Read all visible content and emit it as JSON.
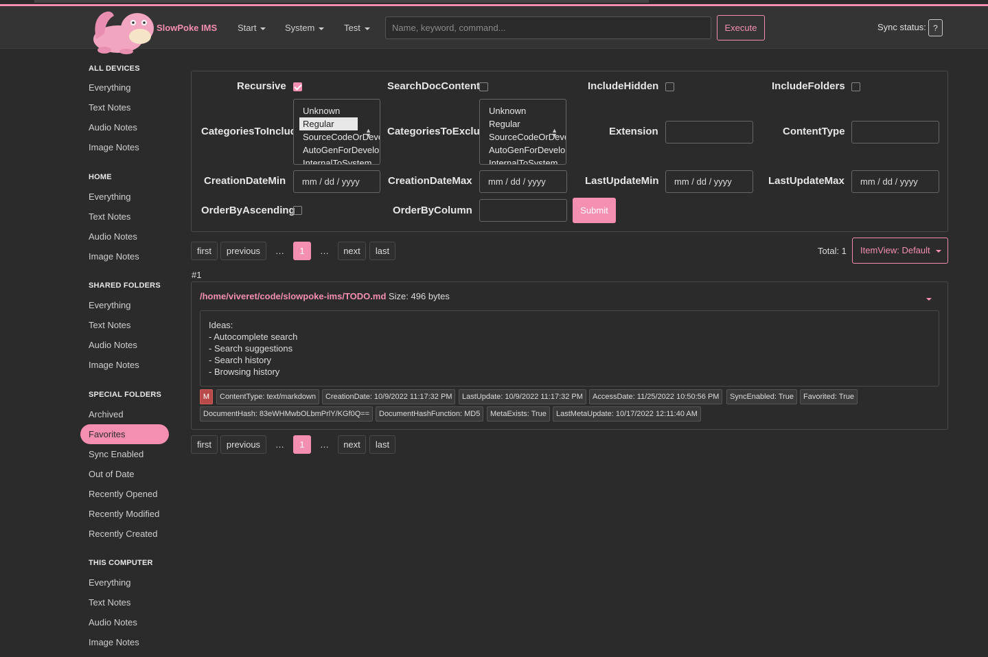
{
  "header": {
    "brand": "SlowPoke IMS",
    "nav": [
      "Start",
      "System",
      "Test"
    ],
    "search_placeholder": "Name, keyword, command...",
    "execute_label": "Execute",
    "sync_label": "Sync status:",
    "sync_value": "?"
  },
  "sidebar": {
    "all_devices": {
      "heading": "ALL DEVICES",
      "items": [
        "Everything",
        "Text Notes",
        "Audio Notes",
        "Image Notes"
      ]
    },
    "home": {
      "heading": "HOME",
      "items": [
        "Everything",
        "Text Notes",
        "Audio Notes",
        "Image Notes"
      ]
    },
    "shared": {
      "heading": "SHARED FOLDERS",
      "items": [
        "Everything",
        "Text Notes",
        "Audio Notes",
        "Image Notes"
      ]
    },
    "special": {
      "heading": "SPECIAL FOLDERS",
      "items": [
        "Archived",
        "Favorites",
        "Sync Enabled",
        "Out of Date",
        "Recently Opened",
        "Recently Modified",
        "Recently Created"
      ],
      "active": "Favorites"
    },
    "computer": {
      "heading": "THIS COMPUTER",
      "items": [
        "Everything",
        "Text Notes",
        "Audio Notes",
        "Image Notes"
      ]
    }
  },
  "filters": {
    "recursive": {
      "label": "Recursive",
      "checked": true
    },
    "search_doc_content": {
      "label": "SearchDocContent",
      "checked": false
    },
    "include_hidden": {
      "label": "IncludeHidden",
      "checked": false
    },
    "include_folders": {
      "label": "IncludeFolders",
      "checked": false
    },
    "categories_include": {
      "label": "CategoriesToInclude",
      "options": [
        "Unknown",
        "Regular",
        "SourceCodeOrDevelopment",
        "AutoGenForDevelopment",
        "InternalToSystem"
      ],
      "selected": "Regular"
    },
    "categories_exclude": {
      "label": "CategoriesToExclude",
      "options": [
        "Unknown",
        "Regular",
        "SourceCodeOrDevelopment",
        "AutoGenForDevelopment",
        "InternalToSystem"
      ]
    },
    "extension": {
      "label": "Extension",
      "value": ""
    },
    "content_type": {
      "label": "ContentType",
      "value": ""
    },
    "creation_date_min": {
      "label": "CreationDateMin",
      "placeholder": "mm / dd / yyyy"
    },
    "creation_date_max": {
      "label": "CreationDateMax",
      "placeholder": "mm / dd / yyyy"
    },
    "last_update_min": {
      "label": "LastUpdateMin",
      "placeholder": "mm / dd / yyyy"
    },
    "last_update_max": {
      "label": "LastUpdateMax",
      "placeholder": "mm / dd / yyyy"
    },
    "order_by_ascending": {
      "label": "OrderByAscending",
      "checked": false
    },
    "order_by_column": {
      "label": "OrderByColumn",
      "value": ""
    },
    "submit_label": "Submit"
  },
  "pagination": {
    "first": "first",
    "previous": "previous",
    "ellipsis": "…",
    "current": "1",
    "next": "next",
    "last": "last",
    "total": "Total: 1",
    "item_view": "ItemView: Default"
  },
  "result": {
    "index": "#1",
    "path": "/home/viveret/code/slowpoke-ims/TODO.md",
    "size": "Size: 496 bytes",
    "content_lines": [
      "Ideas:",
      "- Autocomplete search",
      "- Search suggestions",
      "- Search history",
      "- Browsing history"
    ],
    "badge": "M",
    "tags_row1": [
      "ContentType: text/markdown",
      "CreationDate: 10/9/2022 11:17:32 PM",
      "LastUpdate: 10/9/2022 11:17:32 PM",
      "AccessDate: 11/25/2022 10:50:56 PM",
      "SyncEnabled: True",
      "Favorited: True"
    ],
    "tags_row2": [
      "DocumentHash: 83eWHMwbOLbmPrlY/KGf0Q==",
      "DocumentHashFunction: MD5",
      "MetaExists: True",
      "LastMetaUpdate: 10/17/2022 12:11:40 AM"
    ]
  },
  "colors": {
    "accent": "#f48fb1",
    "background": "#2b2b2b",
    "header": "#343434"
  }
}
